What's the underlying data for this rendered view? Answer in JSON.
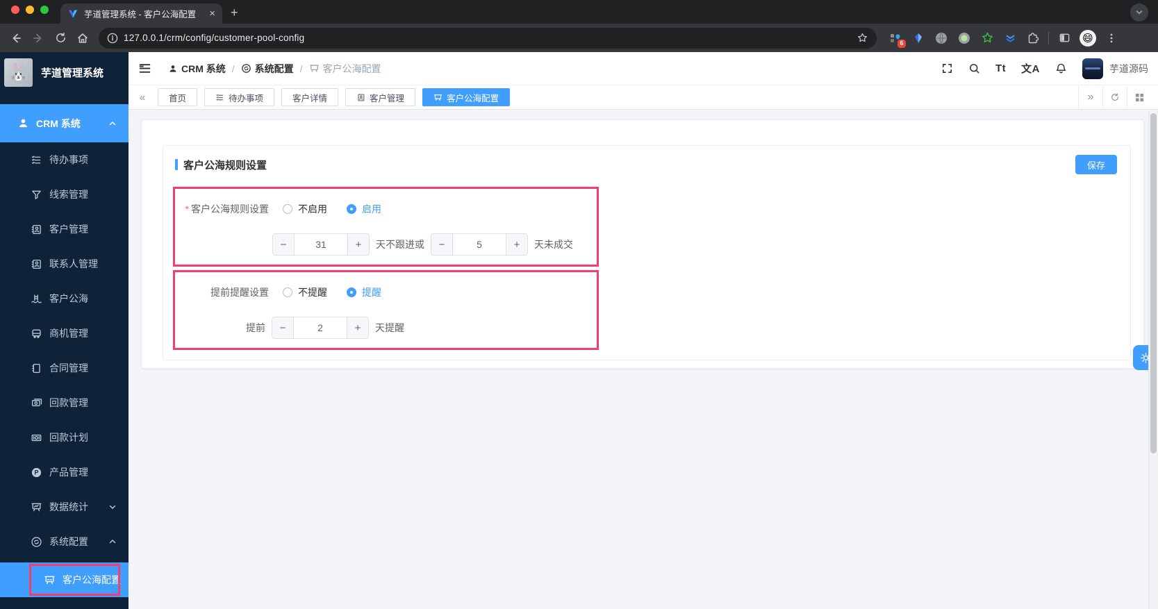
{
  "browser": {
    "tab_title": "芋道管理系统 - 客户公海配置",
    "tab_close": "×",
    "new_tab": "+",
    "url": "127.0.0.1/crm/config/customer-pool-config",
    "extension_badge": "6",
    "profile_emoji": "😄"
  },
  "sidebar": {
    "logo_emoji": "🐰",
    "title": "芋道管理系统",
    "items": [
      {
        "label": "CRM 系统"
      },
      {
        "label": "待办事项"
      },
      {
        "label": "线索管理"
      },
      {
        "label": "客户管理"
      },
      {
        "label": "联系人管理"
      },
      {
        "label": "客户公海"
      },
      {
        "label": "商机管理"
      },
      {
        "label": "合同管理"
      },
      {
        "label": "回款管理"
      },
      {
        "label": "回款计划"
      },
      {
        "label": "产品管理"
      },
      {
        "label": "数据统计"
      },
      {
        "label": "系统配置"
      },
      {
        "label": "客户公海配置"
      }
    ]
  },
  "header": {
    "breadcrumb": [
      {
        "label": "CRM 系统"
      },
      {
        "label": "系统配置"
      },
      {
        "label": "客户公海配置"
      }
    ],
    "separator": "/",
    "font_icon": "Tt",
    "lang_icon": "文A",
    "username": "芋道源码"
  },
  "tabbar": {
    "collapse_left": "«",
    "collapse_right": "»",
    "tabs": [
      {
        "label": "首页"
      },
      {
        "label": "待办事项"
      },
      {
        "label": "客户详情"
      },
      {
        "label": "客户管理"
      },
      {
        "label": "客户公海配置"
      }
    ]
  },
  "form": {
    "section_title": "客户公海规则设置",
    "save_label": "保存",
    "stepper_minus": "−",
    "stepper_plus": "+",
    "rule": {
      "required_mark": "*",
      "label": "客户公海规则设置",
      "option_off": "不启用",
      "option_on": "启用",
      "selected": "启用",
      "days_unfollow": "31",
      "unit_unfollow": "天不跟进或",
      "days_undeal": "5",
      "unit_undeal": "天未成交"
    },
    "remind": {
      "label": "提前提醒设置",
      "option_off": "不提醒",
      "option_on": "提醒",
      "selected": "提醒",
      "prefix": "提前",
      "days": "2",
      "unit": "天提醒"
    }
  },
  "colors": {
    "accent": "#409eff",
    "annotation_pink": "#f43f6e",
    "sidebar_bg": "#0e2338"
  }
}
